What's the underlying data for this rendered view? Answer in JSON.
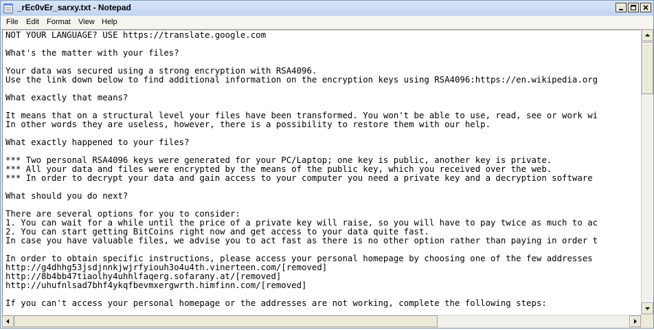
{
  "window": {
    "title": "_rEc0vEr_sarxy.txt - Notepad",
    "icon": "notepad-icon",
    "controls": [
      "minimize-icon",
      "maximize-icon",
      "close-icon"
    ]
  },
  "menu": {
    "items": [
      {
        "label": "File"
      },
      {
        "label": "Edit"
      },
      {
        "label": "Format"
      },
      {
        "label": "View"
      },
      {
        "label": "Help"
      }
    ]
  },
  "document": {
    "lines": [
      "NOT YOUR LANGUAGE? USE https://translate.google.com",
      "",
      "What's the matter with your files?",
      "",
      "Your data was secured using a strong encryption with RSA4096.",
      "Use the link down below to find additional information on the encryption keys using RSA4096:https://en.wikipedia.org",
      "",
      "What exactly that means?",
      "",
      "It means that on a structural level your files have been transformed. You won't be able to use, read, see or work wi",
      "In other words they are useless, however, there is a possibility to restore them with our help.",
      "",
      "What exactly happened to your files?",
      "",
      "*** Two personal RSA4096 keys were generated for your PC/Laptop; one key is public, another key is private.",
      "*** All your data and files were encrypted by the means of the public key, which you received over the web.",
      "*** In order to decrypt your data and gain access to your computer you need a private key and a decryption software",
      "",
      "What should you do next?",
      "",
      "There are several options for you to consider:",
      "1. You can wait for a while until the price of a private key will raise, so you will have to pay twice as much to ac",
      "2. You can start getting BitCoins right now and get access to your data quite fast.",
      "In case you have valuable files, we advise you to act fast as there is no other option rather than paying in order t",
      "",
      "In order to obtain specific instructions, please access your personal homepage by choosing one of the few addresses",
      "http://g4dhhg53jsdjnnkjwjrfyiouh3o4u4th.vinerteen.com/[removed]",
      "http://8b4bb47tiaolhy4uhhlfaqerg.sofarany.at/[removed]",
      "http://uhufnlsad7bhf4ykqfbevmxergwrth.himfinn.com/[removed]",
      "",
      "If you can't access your personal homepage or the addresses are not working, complete the following steps:"
    ]
  },
  "scrollbars": {
    "vertical_icons": [
      "scroll-up-icon",
      "scroll-down-icon"
    ],
    "horizontal_icons": [
      "scroll-left-icon",
      "scroll-right-icon"
    ]
  }
}
